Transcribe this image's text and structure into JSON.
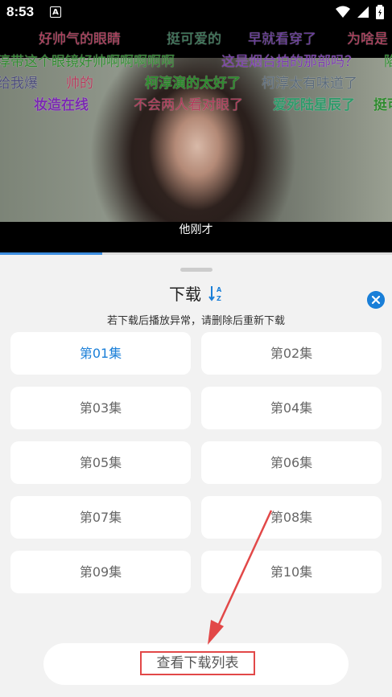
{
  "status_bar": {
    "time": "8:53",
    "notification_icon": "A",
    "icons": [
      "wifi-icon",
      "signal-icon",
      "battery-icon"
    ]
  },
  "video": {
    "subtitle": "他刚才",
    "danmaku": [
      {
        "text": "好帅气的眼睛",
        "color": "#b23a5a"
      },
      {
        "text": "挺可爱的",
        "color": "#3a7a5a"
      },
      {
        "text": "早就看穿了",
        "color": "#6a3aa0"
      },
      {
        "text": "为啥是",
        "color": "#b23a5a"
      },
      {
        "text": "淳带这个眼镜好帅啊啊啊啊啊",
        "color": "#2e8a2e"
      },
      {
        "text": "这是烟台拍的那部吗？",
        "color": "#7a3ab0"
      },
      {
        "text": "陷",
        "color": "#2e8a2e"
      },
      {
        "text": "给我爆",
        "color": "#4a4a7a"
      },
      {
        "text": "帅的",
        "color": "#b23a5a"
      },
      {
        "text": "柯淳演的太好了",
        "color": "#2e8a2e"
      },
      {
        "text": "柯淳太有味道了",
        "color": "#5a6a7a"
      },
      {
        "text": "妆造在线",
        "color": "#7a2ab0"
      },
      {
        "text": "不会两人看对眼了",
        "color": "#b23a5a"
      },
      {
        "text": "爱死陆星辰了",
        "color": "#2e9a6a"
      },
      {
        "text": "挺可",
        "color": "#2e8a2e"
      }
    ],
    "progress": 0.26
  },
  "sheet": {
    "title": "下载",
    "sort_icon": "sort-az-icon",
    "close_icon": "close-icon",
    "notice": "若下载后播放异常，请删除后重新下载",
    "episodes": [
      "第01集",
      "第02集",
      "第03集",
      "第04集",
      "第05集",
      "第06集",
      "第07集",
      "第08集",
      "第09集",
      "第10集"
    ],
    "active_episode": "第01集",
    "view_list_button": "查看下载列表"
  },
  "colors": {
    "accent": "#1a7fd8",
    "highlight_box": "#e24848"
  }
}
